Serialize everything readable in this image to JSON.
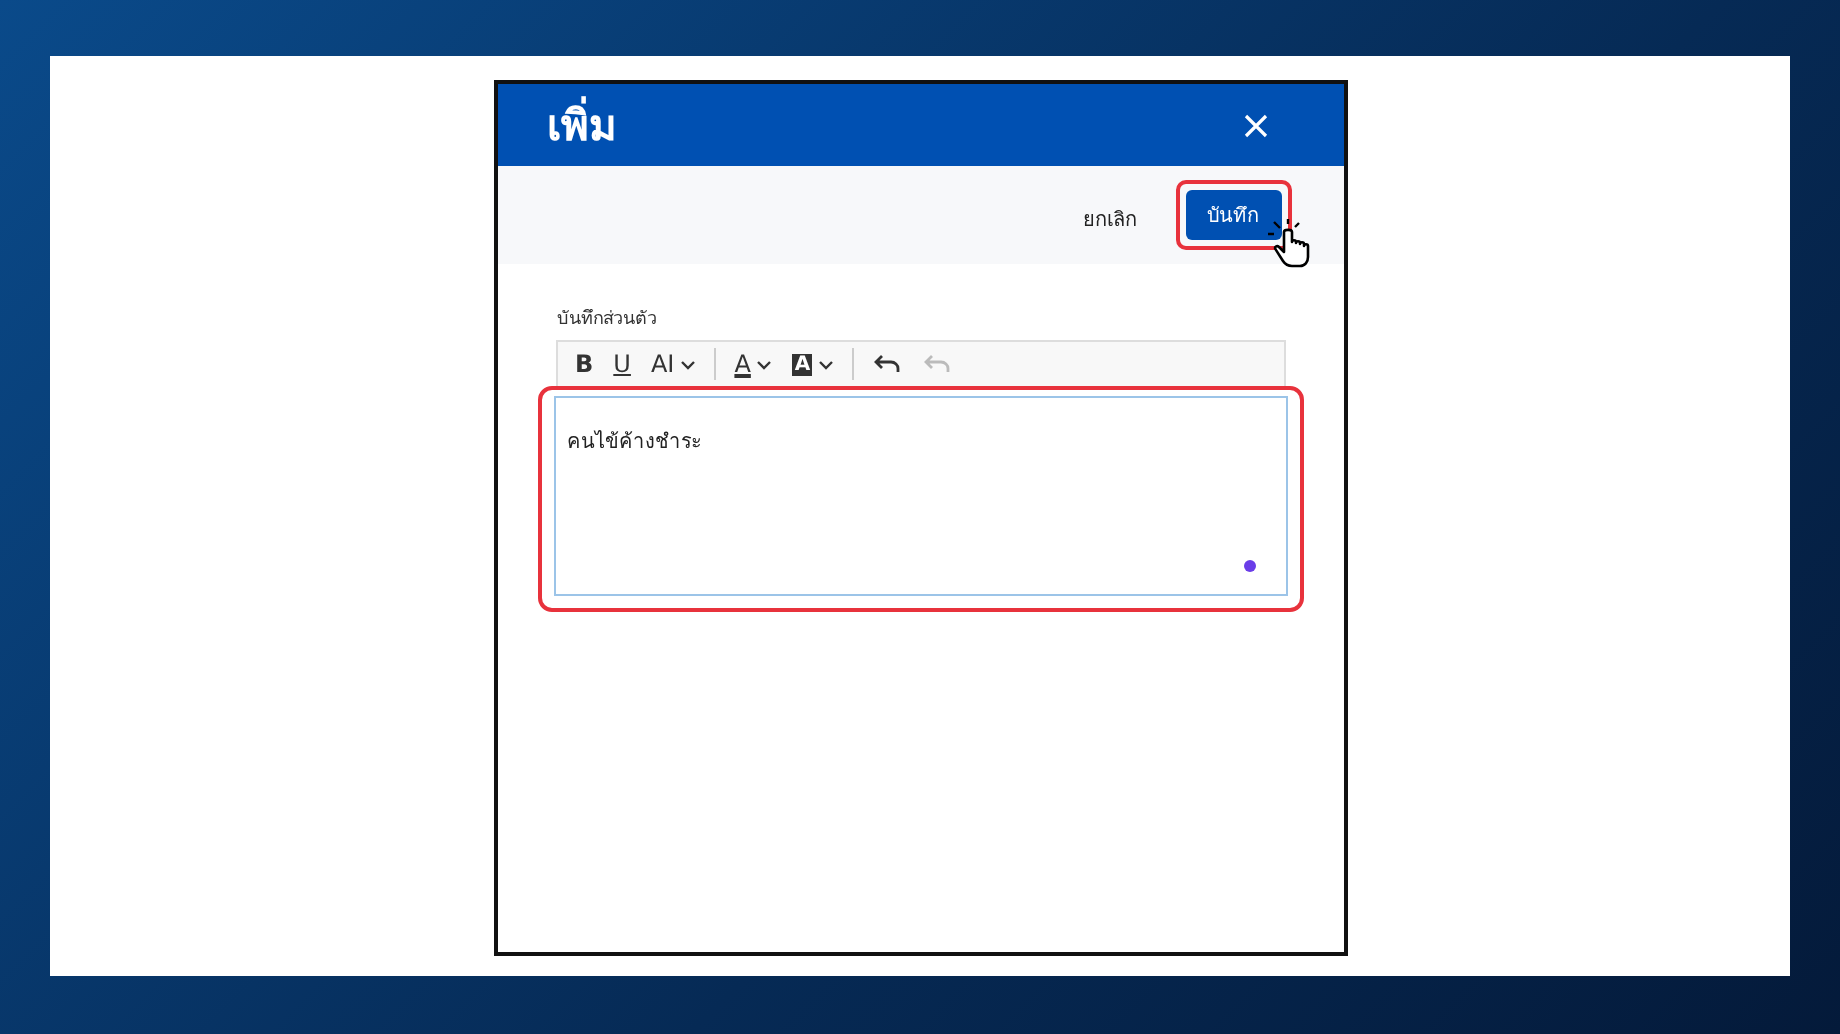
{
  "dialog": {
    "title": "เพิ่ม",
    "actions": [
      {
        "label": "ยกเลิก",
        "kind": "text",
        "highlighted": false
      },
      {
        "label": "บันทึก",
        "kind": "primary",
        "highlighted": true
      }
    ],
    "note_field": {
      "label": "บันทึกส่วนตัว",
      "value": "คนไข้ค้างชำระ",
      "highlighted": true,
      "toolbar": [
        [
          {
            "kind": "bold",
            "label": "B"
          },
          {
            "kind": "underline",
            "label": "U"
          },
          {
            "kind": "font_size",
            "label": "AI"
          }
        ],
        [
          {
            "kind": "text_color",
            "label": "A"
          },
          {
            "kind": "highlight_color",
            "label": "A"
          }
        ],
        [
          {
            "kind": "undo",
            "disabled": false
          },
          {
            "kind": "redo",
            "disabled": true
          }
        ]
      ]
    }
  }
}
